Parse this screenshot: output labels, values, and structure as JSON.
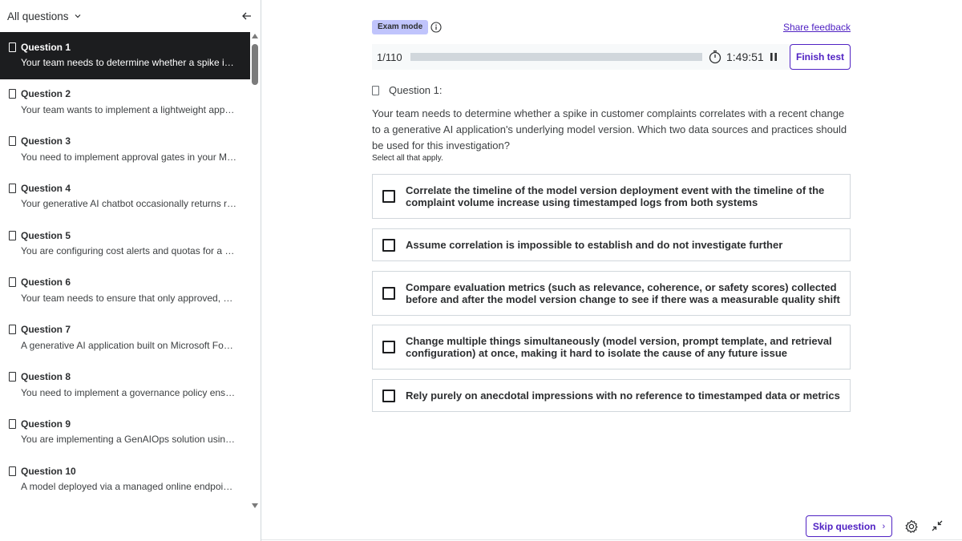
{
  "sidebar": {
    "title": "All questions",
    "icons": {
      "dropdown": "chevron-down-icon",
      "collapse": "arrow-left-icon"
    },
    "items": [
      {
        "label": "Question 1",
        "preview": "Your team needs to determine whether a spike in custo…"
      },
      {
        "label": "Question 2",
        "preview": "Your team wants to implement a lightweight approval w…"
      },
      {
        "label": "Question 3",
        "preview": "You need to implement approval gates in your MLOps p…"
      },
      {
        "label": "Question 4",
        "preview": "Your generative AI chatbot occasionally returns respon…"
      },
      {
        "label": "Question 5",
        "preview": "You are configuring cost alerts and quotas for a shared …"
      },
      {
        "label": "Question 6",
        "preview": "Your team needs to ensure that only approved, scanned…"
      },
      {
        "label": "Question 7",
        "preview": "A generative AI application built on Microsoft Foundry …"
      },
      {
        "label": "Question 8",
        "preview": "You need to implement a governance policy ensuring th…"
      },
      {
        "label": "Question 9",
        "preview": "You are implementing a GenAIOps solution using Micro…"
      },
      {
        "label": "Question 10",
        "preview": "A model deployed via a managed online endpoint must …"
      }
    ]
  },
  "header": {
    "mode_badge": "Exam mode",
    "share_feedback": "Share feedback",
    "progress_text": "1/110",
    "progress_fraction": 0,
    "timer": "1:49:51",
    "finish_button": "Finish test"
  },
  "question": {
    "label": "Question 1:",
    "text": "Your team needs to determine whether a spike in customer complaints correlates with a recent change to a generative AI application's underlying model version. Which two data sources and practices should be used for this investigation?",
    "hint": "Select all that apply.",
    "options": [
      "Correlate the timeline of the model version deployment event with the timeline of the complaint volume increase using timestamped logs from both systems",
      "Assume correlation is impossible to establish and do not investigate further",
      "Compare evaluation metrics (such as relevance, coherence, or safety scores) collected before and after the model version change to see if there was a measurable quality shift",
      "Change multiple things simultaneously (model version, prompt template, and retrieval configuration) at once, making it hard to isolate the cause of any future issue",
      "Rely purely on anecdotal impressions with no reference to timestamped data or metrics"
    ]
  },
  "footer": {
    "skip_button": "Skip question",
    "skip_arrow": "›"
  },
  "colors": {
    "accent": "#5022c3",
    "badge_bg": "#c0c4fc",
    "active_item_bg": "#1c1d1f",
    "border": "#d1d7dc"
  }
}
